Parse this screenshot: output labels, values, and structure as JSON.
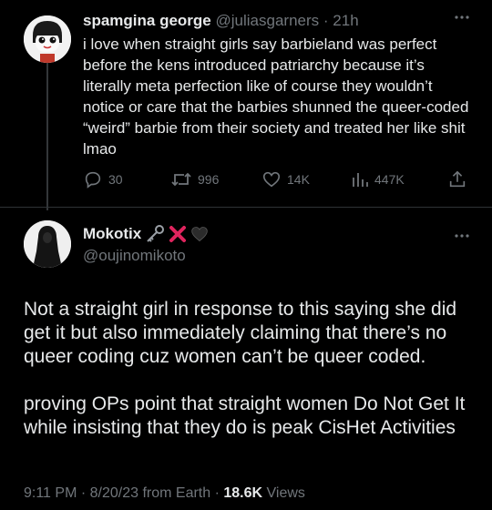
{
  "tweet1": {
    "display_name": "spamgina george",
    "handle": "@juliasgarners",
    "dot": "·",
    "time": "21h",
    "more_icon": "more-icon",
    "text": "i love when straight girls say barbieland was perfect before the kens introduced patriarchy because it’s literally meta perfection like of course they wouldn’t notice or care that the barbies shunned the queer-coded “weird” barbie from their society and treated her like shit lmao",
    "stats": {
      "replies": "30",
      "retweets": "996",
      "likes": "14K",
      "views": "447K"
    }
  },
  "tweet2": {
    "display_name": "Mokotix",
    "name_emojis": [
      "key-icon",
      "cross-mark-icon",
      "black-heart-icon"
    ],
    "handle": "@oujinomikoto",
    "paragraph1": "Not a straight girl in response to this saying she did get it but also immediately claiming that there’s no queer coding cuz women can’t be queer coded.",
    "paragraph2": "proving OPs point that straight women Do Not Get It while insisting that they do is peak CisHet Activities",
    "timestamp": "9:11 PM · 8/20/23 from Earth · ",
    "views_count": "18.6K",
    "views_label": " Views"
  },
  "colors": {
    "background": "#000000",
    "text": "#e7e9ea",
    "muted": "#71767b",
    "divider": "#2f3336",
    "red_x": "#e0245e"
  }
}
